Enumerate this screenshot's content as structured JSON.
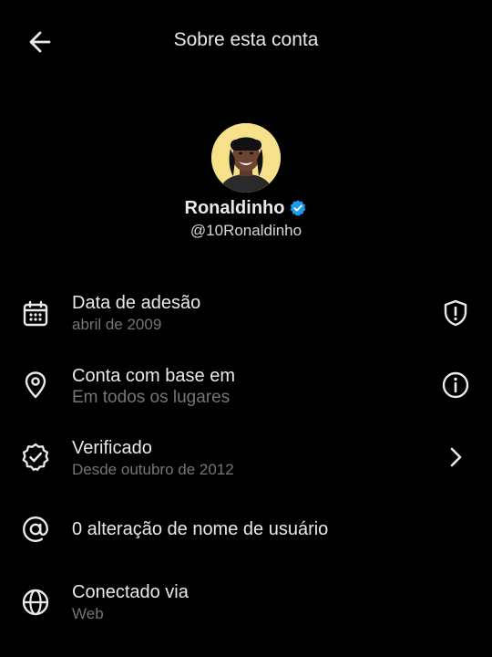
{
  "header": {
    "title": "Sobre esta conta",
    "back_icon": "arrow-left-icon"
  },
  "profile": {
    "name": "Ronaldinho",
    "handle": "@10Ronaldinho",
    "verified": true,
    "verified_color": "#1d9bf0"
  },
  "rows": [
    {
      "icon": "calendar-icon",
      "title": "Data de adesão",
      "subtitle": "abril de 2009",
      "action_icon": "shield-icon"
    },
    {
      "icon": "location-pin-icon",
      "title": "Conta com base em",
      "subtitle": "Em todos os lugares",
      "action_icon": "info-icon"
    },
    {
      "icon": "verified-badge-icon",
      "title": "Verificado",
      "subtitle": "Desde outubro de 2012",
      "action_icon": "chevron-right-icon"
    },
    {
      "icon": "at-sign-icon",
      "title": "0 alteração de nome de usuário"
    },
    {
      "icon": "globe-icon",
      "title": "Conectado via",
      "subtitle": "Web"
    }
  ],
  "colors": {
    "background": "#000000",
    "text_primary": "#e7e9ea",
    "text_secondary": "#71767b",
    "avatar_bg": "#f6e08a"
  }
}
